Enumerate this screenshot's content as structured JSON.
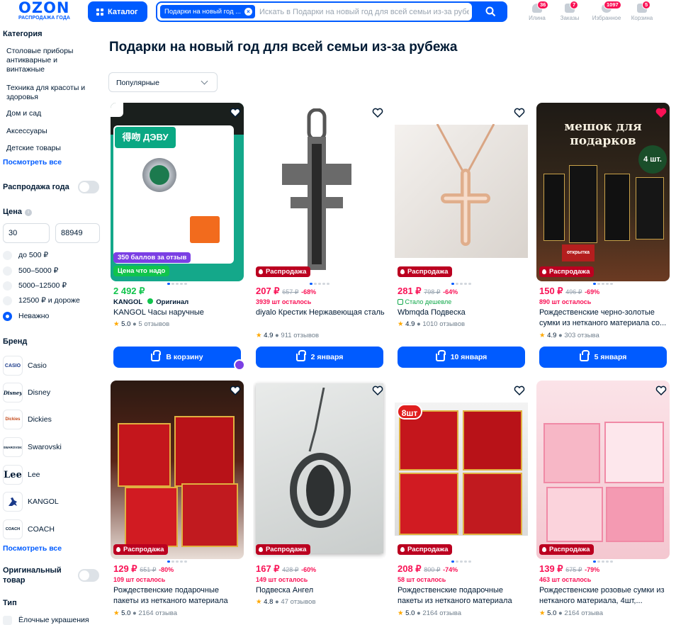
{
  "header": {
    "logo_text": "OZON",
    "logo_subtext": "РАСПРОДАЖА ГОДА",
    "catalog_label": "Каталог",
    "search_chip": "Подарки на новый год ...",
    "search_placeholder": "Искать в Подарки на новый год для всей семьи из-за рубежа",
    "nav": [
      {
        "label": "Илина",
        "badge": "36",
        "icon": "user-icon"
      },
      {
        "label": "Заказы",
        "badge": "7",
        "icon": "box-icon"
      },
      {
        "label": "Избранное",
        "badge": "1097",
        "icon": "heart-icon"
      },
      {
        "label": "Корзина",
        "badge": "5",
        "icon": "cart-icon"
      }
    ]
  },
  "sidebar": {
    "category_title": "Категория",
    "categories": [
      "Столовые приборы антикварные и винтажные",
      "Техника для красоты и здоровья",
      "Дом и сад",
      "Аксессуары",
      "Детские товары"
    ],
    "show_all": "Посмотреть все",
    "sale_label": "Распродажа года",
    "price_title": "Цена",
    "price_min": "30",
    "price_max": "88949",
    "price_ranges": [
      "до 500 ₽",
      "500–5000 ₽",
      "5000–12500 ₽",
      "12500 ₽ и дороже",
      "Неважно"
    ],
    "price_selected": "Неважно",
    "brand_title": "Бренд",
    "brands": [
      {
        "name": "Casio",
        "logo": "CASIO"
      },
      {
        "name": "Disney",
        "logo": "Disney"
      },
      {
        "name": "Dickies",
        "logo": "Dickies"
      },
      {
        "name": "Swarovski",
        "logo": "SWAROVSKI"
      },
      {
        "name": "Lee",
        "logo": "Lee"
      },
      {
        "name": "KANGOL",
        "logo": "KANGOL"
      },
      {
        "name": "COACH",
        "logo": "COACH"
      }
    ],
    "brands_show_all": "Посмотреть все",
    "original_label": "Оригинальный товар",
    "type_title": "Тип",
    "type_first": "Ёлочные украшения"
  },
  "page_title": "Подарки на новый год для всей семьи из-за рубежа",
  "sort_label": "Популярные",
  "products": [
    {
      "price": "2 492 ₽",
      "old_price": "",
      "discount": "",
      "stock": "",
      "seller": "KANGOL",
      "original": "Оригинал",
      "title": "KANGOL Часы наручные",
      "rating": "5.0",
      "reviews": "5 отзывов",
      "button": "В корзину",
      "badge1": "350 баллов за отзыв",
      "badge2": "Цена что надо",
      "image_text": "得吻 ДЭВУ"
    },
    {
      "price": "207 ₽",
      "old_price": "657 ₽",
      "discount": "-68%",
      "stock": "3939 шт осталось",
      "title": "diyalo Крестик Нержавеющая сталь",
      "rating": "4.9",
      "reviews": "911 отзывов",
      "button": "2 января",
      "sale": "Распродажа"
    },
    {
      "price": "281 ₽",
      "old_price": "798 ₽",
      "discount": "-64%",
      "stock": "Стало дешевле",
      "title": "Wbmqda Подвеска",
      "rating": "4.9",
      "reviews": "1010 отзывов",
      "button": "10 января",
      "sale": "Распродажа"
    },
    {
      "price": "150 ₽",
      "old_price": "496 ₽",
      "discount": "-69%",
      "stock": "890 шт осталось",
      "title": "Рождественские черно-золотые сумки из нетканого материала со...",
      "rating": "4.9",
      "reviews": "303 отзыва",
      "button": "5 января",
      "sale": "Распродажа",
      "image_text": "мешок для подарков",
      "image_badge": "4 шт.",
      "image_sticker": "открытка"
    },
    {
      "price": "129 ₽",
      "old_price": "651 ₽",
      "discount": "-80%",
      "stock": "109 шт осталось",
      "title": "Рождественские подарочные пакеты из нетканого материала",
      "rating": "5.0",
      "reviews": "2164 отзыва",
      "sale": "Распродажа"
    },
    {
      "price": "167 ₽",
      "old_price": "428 ₽",
      "discount": "-60%",
      "stock": "149 шт осталось",
      "title": "Подвеска Ангел",
      "rating": "4.8",
      "reviews": "47 отзывов",
      "sale": "Распродажа"
    },
    {
      "price": "208 ₽",
      "old_price": "800 ₽",
      "discount": "-74%",
      "stock": "58 шт осталось",
      "title": "Рождественские подарочные пакеты из нетканого материала",
      "rating": "5.0",
      "reviews": "2164 отзыва",
      "sale": "Распродажа",
      "image_badge": "8шт"
    },
    {
      "price": "139 ₽",
      "old_price": "675 ₽",
      "discount": "-79%",
      "stock": "463 шт осталось",
      "title": "Рождественские розовые сумки из нетканого материала, 4шт,...",
      "rating": "5.0",
      "reviews": "2164 отзыва",
      "sale": "Распродажа"
    }
  ],
  "colors": {
    "accent": "#005bff",
    "sale": "#bb0020",
    "discount": "#f91155",
    "star": "#ffa800",
    "badge_purple": "#7b3fe4",
    "badge_green": "#10c44c"
  }
}
